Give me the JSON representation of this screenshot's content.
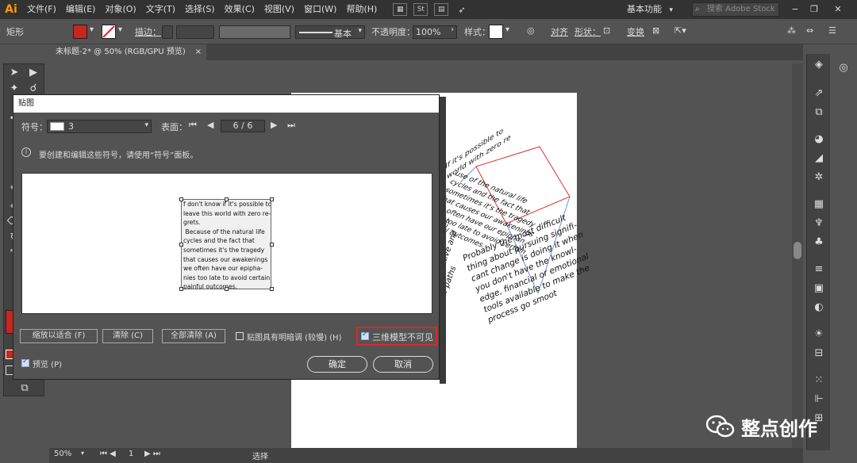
{
  "app": {
    "logo": "Ai",
    "menu": [
      "文件(F)",
      "编辑(E)",
      "对象(O)",
      "文字(T)",
      "选择(S)",
      "效果(C)",
      "视图(V)",
      "窗口(W)",
      "帮助(H)"
    ],
    "workspace": "基本功能",
    "search_placeholder": "搜索 Adobe Stock",
    "window_controls": [
      "−",
      "❐",
      "✕"
    ]
  },
  "controlbar": {
    "object_type": "矩形",
    "stroke_label": "描边：",
    "stroke_style": "基本",
    "opacity_label": "不透明度：",
    "opacity_value": "100%",
    "style_label": "样式：",
    "align_label": "对齐",
    "shape_label": "形状：",
    "transform_label": "变换",
    "fill_color": "#c8261e"
  },
  "document": {
    "tab_title": "未标题-2* @ 50% (RGB/GPU 预览)",
    "tab_close": "×"
  },
  "status": {
    "zoom": "50%",
    "artboard": "1",
    "mode": "选择"
  },
  "cube_art": {
    "top_face": "If it's possible to\nworld with zero re",
    "left_face": "use of the natural life\ncycles and the fact that\nsometimes it's the tragedy\nthat causes our awakenings\nwe often have our epiphan\nnies too late to avoid certain\npainful outcomes.",
    "right_face": "Probably the most difficult\nthing about pursuing signifi-\ncant change is doing it when\nyou don't have the knowl-\nedge, financial or emotional\ntools available to make the\nprocess go smoot",
    "side_face": "thing blessing as it forces\nyou to get creative and\nfind new paths"
  },
  "dialog": {
    "title": "贴图",
    "symbol_label": "符号：",
    "symbol_value": "3",
    "surface_label": "表面：",
    "surface_value": "6 / 6",
    "info": "要创建和编辑这些符号，请使用“符号”面板。",
    "mapped_text": "f don't know if it's possible to\nleave this world with zero re-\ngrets.\n Because of the natural life\ncycles and the fact that\nsometimes it's the tragedy\nthat causes our awakenings\nwe often have our epipha-\nnies too late to avoid certain\npainful outcomes.",
    "buttons": {
      "fit": "缩放以适合 (F)",
      "clear": "清除 (C)",
      "clear_all": "全部清除 (A)",
      "ok": "确定",
      "cancel": "取消"
    },
    "shade_label": "贴图具有明暗调 (较慢) (H)",
    "shade_checked": false,
    "invisible_label": "三维模型不可见",
    "invisible_checked": true,
    "preview_label": "预览 (P)",
    "preview_checked": true,
    "highlight_color": "#e0262a"
  },
  "watermark": {
    "text": "整点创作"
  }
}
